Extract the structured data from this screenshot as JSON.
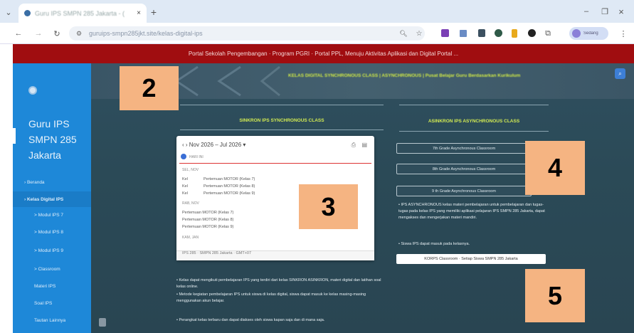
{
  "browser": {
    "tab_title": "Guru IPS SMPN 285 Jakarta - (",
    "url": "guruips-smpn285jkt.site/kelas-digital-ips",
    "profile_label": "Sedang"
  },
  "banner": {
    "text": "Portal Sekolah Pengembangan · Program PGRI · Portal PPL, Menuju Aktivitas Aplikasi dan Digital Portal ..."
  },
  "sidebar": {
    "site_title_1": "Guru IPS",
    "site_title_2": "SMPN 285",
    "site_title_3": "Jakarta",
    "items": [
      {
        "label": "› Beranda"
      },
      {
        "label": "› Kelas Digital IPS"
      },
      {
        "label": "> Modul IPS 7"
      },
      {
        "label": "> Modul IPS 8"
      },
      {
        "label": "> Modul IPS 9"
      },
      {
        "label": "> Classroom"
      },
      {
        "label": "Materi IPS"
      },
      {
        "label": "Soal IPS"
      },
      {
        "label": "Tautan Lainnya"
      }
    ]
  },
  "main": {
    "marquee": "KELAS DIGITAL SYNCHRONOUS CLASS | ASYNCHRONOUS | Pusat Belajar Guru Berdasarkan Kurikulum",
    "left_heading": "SINKRON IPS SYNCHRONOUS CLASS",
    "right_heading": "ASINKRON IPS ASYNCHRONOUS CLASS",
    "calendar": {
      "range": "Nov 2026 – Jul 2026",
      "today_label": "HARI INI",
      "date_1": "SEL, NOV",
      "events_1": [
        "Pertemuan MOTOR (Kelas 7)",
        "Pertemuan MOTOR (Kelas 8)",
        "Pertemuan MOTOR (Kelas 9)"
      ],
      "event_day": "Kel",
      "date_2": "RAB, NOV",
      "events_2": [
        "Pertemuan MOTOR (Kelas 7)",
        "Pertemuan MOTOR (Kelas 8)",
        "Pertemuan MOTOR (Kelas 9)"
      ],
      "date_3": "KAM, JAN",
      "footer": "IPS 285 · SMPN 285 Jakarta · GMT+07"
    },
    "right_buttons": [
      "7th Grade Asynchronous Classroom",
      "8th Grade Asynchronous Classroom",
      "9 th Grade Asynchronous Classroom"
    ],
    "right_bullets": [
      "IPS ASYNCHRONOUS kelas materi pembelajaran untuk pembelajaran dan tugas-tugas pada kelas IPS yang memiliki aplikasi pelajaran IPS SMPN 285 Jakarta, dapat mengakses dan mengerjakan materi mandiri.",
      "Siswa IPS dapat masuk pada kelasnya."
    ],
    "lower_button": "KORPS Classroom · Setiap Siswa SMPN 285 Jakarta",
    "bottom_bullets": [
      "Kelas dapat mengikuti pembelajaran IPS yang terdiri dari kelas SINKRON ASINKRON, materi digital dan latihan soal kelas online.",
      "Metode kegiatan pembelajaran IPS untuk siswa di kelas digital, siswa dapat masuk ke kelas masing-masing menggunakan akun belajar.",
      "Perangkat kelas terbaru dan dapat diakses oleh siswa kapan saja dan di mana saja."
    ]
  },
  "overlay_labels": [
    "2",
    "3",
    "4",
    "5"
  ]
}
